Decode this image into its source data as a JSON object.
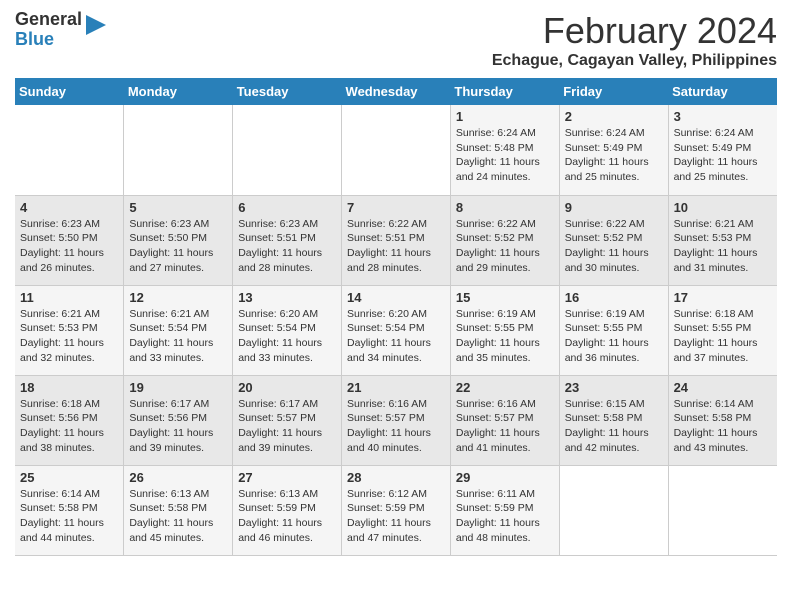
{
  "logo": {
    "line1": "General",
    "line2": "Blue"
  },
  "title": "February 2024",
  "subtitle": "Echague, Cagayan Valley, Philippines",
  "days_header": [
    "Sunday",
    "Monday",
    "Tuesday",
    "Wednesday",
    "Thursday",
    "Friday",
    "Saturday"
  ],
  "weeks": [
    [
      {
        "num": "",
        "text": ""
      },
      {
        "num": "",
        "text": ""
      },
      {
        "num": "",
        "text": ""
      },
      {
        "num": "",
        "text": ""
      },
      {
        "num": "1",
        "text": "Sunrise: 6:24 AM\nSunset: 5:48 PM\nDaylight: 11 hours and 24 minutes."
      },
      {
        "num": "2",
        "text": "Sunrise: 6:24 AM\nSunset: 5:49 PM\nDaylight: 11 hours and 25 minutes."
      },
      {
        "num": "3",
        "text": "Sunrise: 6:24 AM\nSunset: 5:49 PM\nDaylight: 11 hours and 25 minutes."
      }
    ],
    [
      {
        "num": "4",
        "text": "Sunrise: 6:23 AM\nSunset: 5:50 PM\nDaylight: 11 hours and 26 minutes."
      },
      {
        "num": "5",
        "text": "Sunrise: 6:23 AM\nSunset: 5:50 PM\nDaylight: 11 hours and 27 minutes."
      },
      {
        "num": "6",
        "text": "Sunrise: 6:23 AM\nSunset: 5:51 PM\nDaylight: 11 hours and 28 minutes."
      },
      {
        "num": "7",
        "text": "Sunrise: 6:22 AM\nSunset: 5:51 PM\nDaylight: 11 hours and 28 minutes."
      },
      {
        "num": "8",
        "text": "Sunrise: 6:22 AM\nSunset: 5:52 PM\nDaylight: 11 hours and 29 minutes."
      },
      {
        "num": "9",
        "text": "Sunrise: 6:22 AM\nSunset: 5:52 PM\nDaylight: 11 hours and 30 minutes."
      },
      {
        "num": "10",
        "text": "Sunrise: 6:21 AM\nSunset: 5:53 PM\nDaylight: 11 hours and 31 minutes."
      }
    ],
    [
      {
        "num": "11",
        "text": "Sunrise: 6:21 AM\nSunset: 5:53 PM\nDaylight: 11 hours and 32 minutes."
      },
      {
        "num": "12",
        "text": "Sunrise: 6:21 AM\nSunset: 5:54 PM\nDaylight: 11 hours and 33 minutes."
      },
      {
        "num": "13",
        "text": "Sunrise: 6:20 AM\nSunset: 5:54 PM\nDaylight: 11 hours and 33 minutes."
      },
      {
        "num": "14",
        "text": "Sunrise: 6:20 AM\nSunset: 5:54 PM\nDaylight: 11 hours and 34 minutes."
      },
      {
        "num": "15",
        "text": "Sunrise: 6:19 AM\nSunset: 5:55 PM\nDaylight: 11 hours and 35 minutes."
      },
      {
        "num": "16",
        "text": "Sunrise: 6:19 AM\nSunset: 5:55 PM\nDaylight: 11 hours and 36 minutes."
      },
      {
        "num": "17",
        "text": "Sunrise: 6:18 AM\nSunset: 5:55 PM\nDaylight: 11 hours and 37 minutes."
      }
    ],
    [
      {
        "num": "18",
        "text": "Sunrise: 6:18 AM\nSunset: 5:56 PM\nDaylight: 11 hours and 38 minutes."
      },
      {
        "num": "19",
        "text": "Sunrise: 6:17 AM\nSunset: 5:56 PM\nDaylight: 11 hours and 39 minutes."
      },
      {
        "num": "20",
        "text": "Sunrise: 6:17 AM\nSunset: 5:57 PM\nDaylight: 11 hours and 39 minutes."
      },
      {
        "num": "21",
        "text": "Sunrise: 6:16 AM\nSunset: 5:57 PM\nDaylight: 11 hours and 40 minutes."
      },
      {
        "num": "22",
        "text": "Sunrise: 6:16 AM\nSunset: 5:57 PM\nDaylight: 11 hours and 41 minutes."
      },
      {
        "num": "23",
        "text": "Sunrise: 6:15 AM\nSunset: 5:58 PM\nDaylight: 11 hours and 42 minutes."
      },
      {
        "num": "24",
        "text": "Sunrise: 6:14 AM\nSunset: 5:58 PM\nDaylight: 11 hours and 43 minutes."
      }
    ],
    [
      {
        "num": "25",
        "text": "Sunrise: 6:14 AM\nSunset: 5:58 PM\nDaylight: 11 hours and 44 minutes."
      },
      {
        "num": "26",
        "text": "Sunrise: 6:13 AM\nSunset: 5:58 PM\nDaylight: 11 hours and 45 minutes."
      },
      {
        "num": "27",
        "text": "Sunrise: 6:13 AM\nSunset: 5:59 PM\nDaylight: 11 hours and 46 minutes."
      },
      {
        "num": "28",
        "text": "Sunrise: 6:12 AM\nSunset: 5:59 PM\nDaylight: 11 hours and 47 minutes."
      },
      {
        "num": "29",
        "text": "Sunrise: 6:11 AM\nSunset: 5:59 PM\nDaylight: 11 hours and 48 minutes."
      },
      {
        "num": "",
        "text": ""
      },
      {
        "num": "",
        "text": ""
      }
    ]
  ]
}
